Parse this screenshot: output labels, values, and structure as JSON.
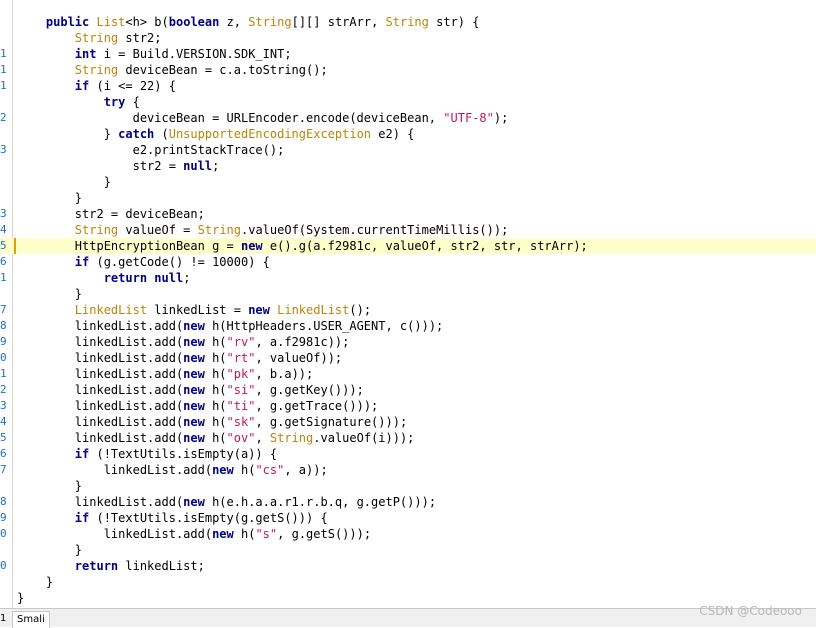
{
  "gutter_numbers": [
    "1",
    "1",
    "1",
    "2",
    "3",
    "3",
    "4",
    "5",
    "6",
    "1",
    "7",
    "8",
    "9",
    "0",
    "1",
    "2",
    "3",
    "4",
    "5",
    "6",
    "7",
    "8",
    "9",
    "0",
    "0"
  ],
  "code_lines": [
    {
      "text": "    public List<h> b(boolean z, String[][] strArr, String str) {",
      "ln": ""
    },
    {
      "text": "        String str2;",
      "ln": ""
    },
    {
      "text": "        int i = Build.VERSION.SDK_INT;",
      "ln": "1"
    },
    {
      "text": "        String deviceBean = c.a.toString();",
      "ln": "1"
    },
    {
      "text": "        if (i <= 22) {",
      "ln": "1"
    },
    {
      "text": "            try {",
      "ln": ""
    },
    {
      "text": "                deviceBean = URLEncoder.encode(deviceBean, \"UTF-8\");",
      "ln": "2"
    },
    {
      "text": "            } catch (UnsupportedEncodingException e2) {",
      "ln": ""
    },
    {
      "text": "                e2.printStackTrace();",
      "ln": "3"
    },
    {
      "text": "                str2 = null;",
      "ln": ""
    },
    {
      "text": "            }",
      "ln": ""
    },
    {
      "text": "        }",
      "ln": ""
    },
    {
      "text": "        str2 = deviceBean;",
      "ln": "3"
    },
    {
      "text": "        String valueOf = String.valueOf(System.currentTimeMillis());",
      "ln": "4"
    },
    {
      "text": "        HttpEncryptionBean g = new e().g(a.f2981c, valueOf, str2, str, strArr);",
      "ln": "5"
    },
    {
      "text": "        if (g.getCode() != 10000) {",
      "ln": "6"
    },
    {
      "text": "            return null;",
      "ln": "1"
    },
    {
      "text": "        }",
      "ln": ""
    },
    {
      "text": "        LinkedList linkedList = new LinkedList();",
      "ln": "7"
    },
    {
      "text": "        linkedList.add(new h(HttpHeaders.USER_AGENT, c()));",
      "ln": "8"
    },
    {
      "text": "        linkedList.add(new h(\"rv\", a.f2981c));",
      "ln": "9"
    },
    {
      "text": "        linkedList.add(new h(\"rt\", valueOf));",
      "ln": "0"
    },
    {
      "text": "        linkedList.add(new h(\"pk\", b.a));",
      "ln": "1"
    },
    {
      "text": "        linkedList.add(new h(\"si\", g.getKey()));",
      "ln": "2"
    },
    {
      "text": "        linkedList.add(new h(\"ti\", g.getTrace()));",
      "ln": "3"
    },
    {
      "text": "        linkedList.add(new h(\"sk\", g.getSignature()));",
      "ln": "4"
    },
    {
      "text": "        linkedList.add(new h(\"ov\", String.valueOf(i)));",
      "ln": "5"
    },
    {
      "text": "        if (!TextUtils.isEmpty(a)) {",
      "ln": "6"
    },
    {
      "text": "            linkedList.add(new h(\"cs\", a));",
      "ln": "7"
    },
    {
      "text": "        }",
      "ln": ""
    },
    {
      "text": "        linkedList.add(new h(e.h.a.a.r1.r.b.q, g.getP()));",
      "ln": "8"
    },
    {
      "text": "        if (!TextUtils.isEmpty(g.getS())) {",
      "ln": "9"
    },
    {
      "text": "            linkedList.add(new h(\"s\", g.getS()));",
      "ln": "0"
    },
    {
      "text": "        }",
      "ln": ""
    },
    {
      "text": "        return linkedList;",
      "ln": "0"
    },
    {
      "text": "    }",
      "ln": ""
    },
    {
      "text": "}",
      "ln": ""
    }
  ],
  "highlighted_line_index": 14,
  "tabs": {
    "left_fragment": "1",
    "smali_label": "Smali"
  },
  "watermark": "CSDN @Codeooo",
  "colors": {
    "keyword": "#000080",
    "type": "#b8860b",
    "string": "#c2185b",
    "line_number": "#1f6fc5",
    "highlight": "#ffffcc"
  }
}
